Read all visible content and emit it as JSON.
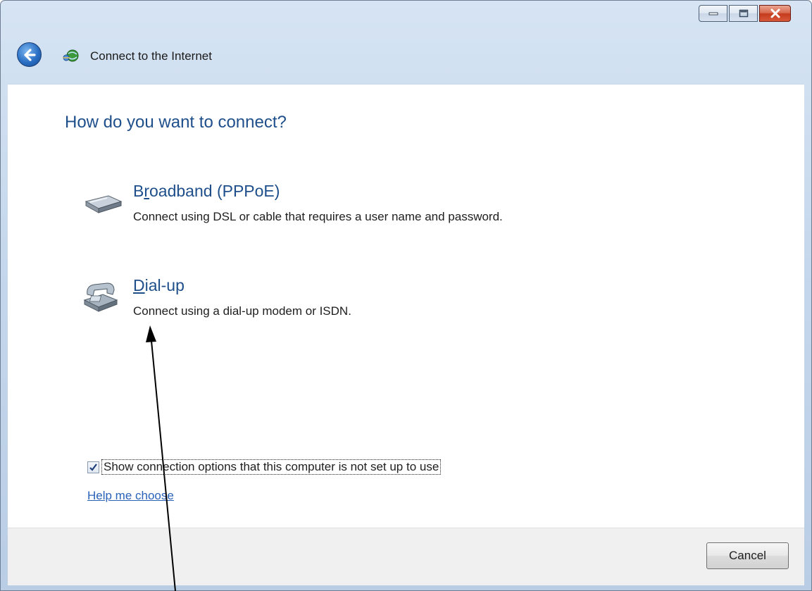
{
  "window": {
    "title": "Connect to the Internet",
    "icons": {
      "back": "back-arrow-icon",
      "title": "network-globe-icon",
      "minimize": "minimize-icon",
      "maximize": "maximize-icon",
      "close": "close-icon"
    }
  },
  "content": {
    "heading": "How do you want to connect?",
    "options": [
      {
        "title_pre": "B",
        "title_accel": "r",
        "title_post": "oadband (PPPoE)",
        "description": "Connect using DSL or cable that requires a user name and password.",
        "icon": "broadband-modem-icon"
      },
      {
        "title_pre": "",
        "title_accel": "D",
        "title_post": "ial-up",
        "description": "Connect using a dial-up modem or ISDN.",
        "icon": "telephone-modem-icon"
      }
    ],
    "show_options_checkbox": {
      "label": "Show connection options that this computer is not set up to use",
      "checked": true
    },
    "help_link": "Help me choose"
  },
  "footer": {
    "cancel_label": "Cancel"
  },
  "colors": {
    "heading": "#1f4f8b",
    "link": "#2a62b8",
    "close_button": "#c43a1c"
  }
}
